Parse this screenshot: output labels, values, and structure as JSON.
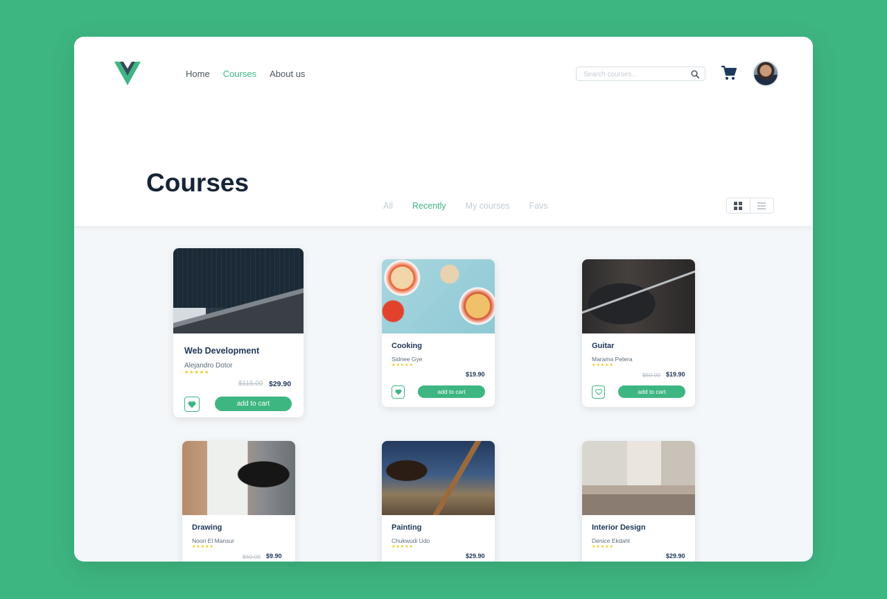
{
  "nav": {
    "items": [
      {
        "label": "Home"
      },
      {
        "label": "Courses"
      },
      {
        "label": "About us"
      }
    ]
  },
  "search": {
    "placeholder": "Search courses...",
    "value": ""
  },
  "page": {
    "title": "Courses"
  },
  "tabs": [
    {
      "label": "All"
    },
    {
      "label": "Recently"
    },
    {
      "label": "My courses"
    },
    {
      "label": "Favs"
    }
  ],
  "view_toggle": {
    "active": "grid",
    "icons": [
      "grid-icon",
      "list-icon"
    ]
  },
  "colors": {
    "brand": "#3eb682",
    "brand_dark": "#35495e",
    "heading": "#152436",
    "star": "#f2c511",
    "background": "#3eb682"
  },
  "courses": [
    {
      "title": "Web Development",
      "author": "Alejandro Dotor",
      "stars": "★★★★★",
      "old_price": "$115.00",
      "price": "$29.90",
      "button": "add to cart",
      "favorited": true
    },
    {
      "title": "Cooking",
      "author": "Sidnee Gye",
      "stars": "★★★★★",
      "old_price": "",
      "price": "$19.90",
      "button": "add to cart",
      "favorited": true
    },
    {
      "title": "Guitar",
      "author": "Marama Petera",
      "stars": "★★★★★",
      "old_price": "$60.00",
      "price": "$19.90",
      "button": "add to cart",
      "favorited": false
    },
    {
      "title": "Drawing",
      "author": "Noori El Mansur",
      "stars": "★★★★★",
      "old_price": "$60.00",
      "price": "$9.90"
    },
    {
      "title": "Painting",
      "author": "Chukwudi Udo",
      "stars": "★★★★★",
      "old_price": "",
      "price": "$29.90"
    },
    {
      "title": "Interior Design",
      "author": "Denice Ekdahl",
      "stars": "★★★★★",
      "old_price": "",
      "price": "$29.90"
    }
  ]
}
